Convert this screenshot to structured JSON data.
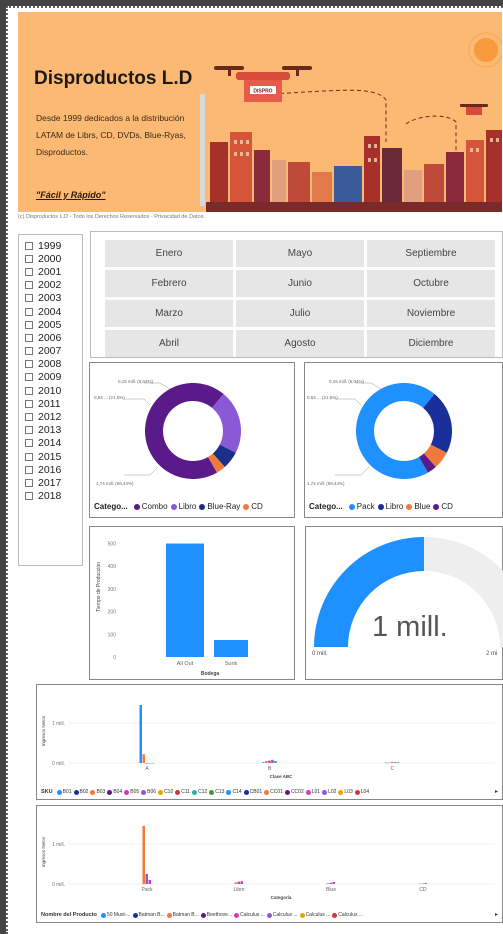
{
  "banner": {
    "title": "Disproductos L.D",
    "description": "Desde 1999 dedicados a la distribución LATAM  de Librs, CD, DVDs, Blue-Ryas, Disproductos.",
    "slogan": "\"Fácil y Rápido\"",
    "truck_text": "DISPRO"
  },
  "copyright": "(c) Disproductos L.D - Todo los Derechos Reservados - Privacidad de Datos.",
  "years": [
    "1999",
    "2000",
    "2001",
    "2002",
    "2003",
    "2004",
    "2005",
    "2006",
    "2007",
    "2008",
    "2009",
    "2010",
    "2011",
    "2012",
    "2013",
    "2014",
    "2015",
    "2016",
    "2017",
    "2018"
  ],
  "months": [
    "Enero",
    "Mayo",
    "Septiembre",
    "Febrero",
    "Junio",
    "Octubre",
    "Marzo",
    "Julio",
    "Noviembre",
    "Abril",
    "Agosto",
    "Diciembre"
  ],
  "donut1": {
    "legend_title": "Catego...",
    "legend": [
      {
        "label": "Combo",
        "color": "#5b1a8a"
      },
      {
        "label": "Libro",
        "color": "#8a5ad6"
      },
      {
        "label": "Blue-Ray",
        "color": "#1a2f8a"
      },
      {
        "label": "CD",
        "color": "#f07a3a"
      }
    ],
    "label_top": "0,15 mill. (6,04%)",
    "label_left": "0,54 ... (21,5%)",
    "label_bottom": "1,74 mill. (69,44%)"
  },
  "donut2": {
    "legend_title": "Catego...",
    "legend": [
      {
        "label": "Pack",
        "color": "#1e90ff"
      },
      {
        "label": "Libro",
        "color": "#1a2f9a"
      },
      {
        "label": "Blue",
        "color": "#f07a3a"
      },
      {
        "label": "CD",
        "color": "#5b1a8a"
      }
    ],
    "label_top": "0,15 mill. (6,04%)",
    "label_left": "0,54 ... (21,5%)",
    "label_bottom": "1,74 mill. (69,44%)"
  },
  "gauge": {
    "value_text": "1 mill.",
    "min_text": "0 mill.",
    "max_text": "2 mi",
    "fill_fraction": 0.5,
    "color": "#1e90ff"
  },
  "wide1": {
    "legend_title": "SKU",
    "legend": [
      {
        "label": "B01",
        "color": "#1e90ff"
      },
      {
        "label": "B02",
        "color": "#1a2f9a"
      },
      {
        "label": "B03",
        "color": "#f07a3a"
      },
      {
        "label": "B04",
        "color": "#5b1a8a"
      },
      {
        "label": "B05",
        "color": "#d63ab0"
      },
      {
        "label": "B06",
        "color": "#8a5ad6"
      },
      {
        "label": "C10",
        "color": "#e0a800"
      },
      {
        "label": "C11",
        "color": "#d6303a"
      },
      {
        "label": "C12",
        "color": "#2ab0a0"
      },
      {
        "label": "C13",
        "color": "#3a9a3a"
      },
      {
        "label": "C14",
        "color": "#1e90ff"
      },
      {
        "label": "CB01",
        "color": "#1a2f9a"
      },
      {
        "label": "CC01",
        "color": "#f07a3a"
      },
      {
        "label": "CC02",
        "color": "#5b1a8a"
      },
      {
        "label": "L01",
        "color": "#d63ab0"
      },
      {
        "label": "L02",
        "color": "#8a5ad6"
      },
      {
        "label": "L03",
        "color": "#e0a800"
      },
      {
        "label": "L04",
        "color": "#d6303a"
      }
    ]
  },
  "wide2": {
    "legend_title": "Nombre del Producto",
    "legend": [
      {
        "label": "50 Must-...",
        "color": "#1e90ff"
      },
      {
        "label": "Batman B...",
        "color": "#1a2f9a"
      },
      {
        "label": "Batman B...",
        "color": "#f07a3a"
      },
      {
        "label": "Beethove...",
        "color": "#5b1a8a"
      },
      {
        "label": "Calculus ...",
        "color": "#d63ab0"
      },
      {
        "label": "Calculus ...",
        "color": "#8a5ad6"
      },
      {
        "label": "Calculus ...",
        "color": "#e0a800"
      },
      {
        "label": "Calculus ...",
        "color": "#d6303a"
      }
    ]
  },
  "chart_data": [
    {
      "type": "pie",
      "title": "",
      "categories": [
        "Combo",
        "Libro",
        "Blue-Ray",
        "CD"
      ],
      "values": [
        1.74,
        0.54,
        0.15,
        0.08
      ],
      "colors": [
        "#5b1a8a",
        "#8a5ad6",
        "#1a2f8a",
        "#f07a3a"
      ]
    },
    {
      "type": "pie",
      "title": "",
      "categories": [
        "Pack",
        "Libro",
        "Blue",
        "CD"
      ],
      "values": [
        1.74,
        0.54,
        0.15,
        0.08
      ],
      "colors": [
        "#1e90ff",
        "#1a2f9a",
        "#f07a3a",
        "#5b1a8a"
      ]
    },
    {
      "type": "bar",
      "title": "",
      "xlabel": "Bodega",
      "ylabel": "Tiempo de Producción",
      "categories": [
        "All Out",
        "Sunk"
      ],
      "values": [
        500,
        75
      ],
      "yticks": [
        "0",
        "100",
        "200",
        "300",
        "400",
        "500"
      ],
      "ylim": [
        0,
        520
      ],
      "color": "#1e90ff"
    },
    {
      "type": "bar",
      "title": "",
      "xlabel": "Clase ABC",
      "ylabel": "Ingresos Netos",
      "categories": [
        "A",
        "B",
        "C"
      ],
      "yticks": [
        "0 mill.",
        "1 mill."
      ],
      "ylim": [
        0,
        1.6
      ],
      "series": [
        {
          "name": "B01",
          "values": [
            1.45,
            0.02,
            0.01
          ],
          "color": "#1e90ff"
        },
        {
          "name": "B03",
          "values": [
            0.22,
            0.05,
            0.01
          ],
          "color": "#f07a3a"
        },
        {
          "name": "B05",
          "values": [
            0,
            0.06,
            0.02
          ],
          "color": "#d63ab0"
        },
        {
          "name": "B06",
          "values": [
            0,
            0.08,
            0.02
          ],
          "color": "#8a5ad6"
        },
        {
          "name": "C14",
          "values": [
            0,
            0.05,
            0.02
          ],
          "color": "#2ab0a0"
        }
      ]
    },
    {
      "type": "bar",
      "title": "",
      "xlabel": "Categoría",
      "ylabel": "Ingresos Netos",
      "categories": [
        "Pack",
        "Libro",
        "Blue",
        "CD"
      ],
      "yticks": [
        "0 mill.",
        "1 mill."
      ],
      "ylim": [
        0,
        1.6
      ],
      "series": [
        {
          "name": "Batman B...",
          "values": [
            1.45,
            0.04,
            0.02,
            0.01
          ],
          "color": "#f07a3a"
        },
        {
          "name": "Beethove...",
          "values": [
            0.25,
            0.06,
            0.03,
            0.01
          ],
          "color": "#8a5ad6"
        },
        {
          "name": "Calculus ...",
          "values": [
            0.1,
            0.07,
            0.05,
            0.02
          ],
          "color": "#d63ab0"
        }
      ]
    }
  ]
}
